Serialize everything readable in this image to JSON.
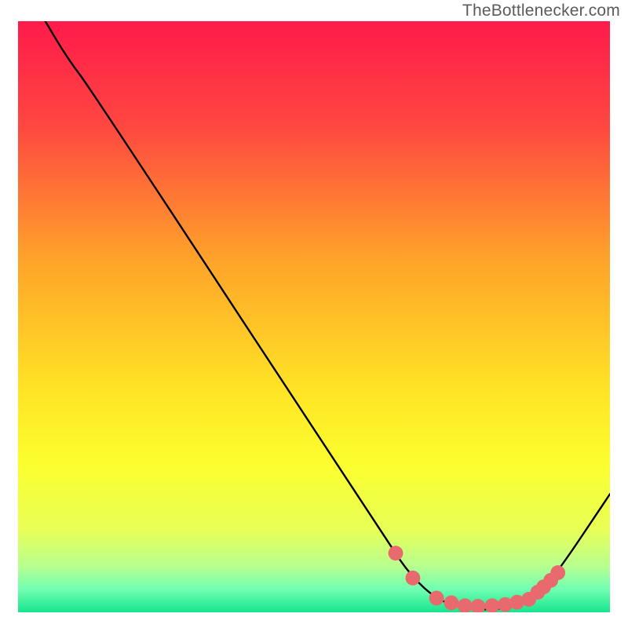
{
  "attribution": "TheBottlenecker.com",
  "chart_data": {
    "type": "line",
    "title": "",
    "xlabel": "",
    "ylabel": "",
    "xlim": [
      0,
      100
    ],
    "ylim": [
      0,
      100
    ],
    "gradient_stops": [
      {
        "offset": 0,
        "color": "#ff1a4b"
      },
      {
        "offset": 18,
        "color": "#ff4840"
      },
      {
        "offset": 40,
        "color": "#ffa22a"
      },
      {
        "offset": 62,
        "color": "#ffe325"
      },
      {
        "offset": 75,
        "color": "#fbff2e"
      },
      {
        "offset": 86,
        "color": "#e8ff56"
      },
      {
        "offset": 92,
        "color": "#baff8e"
      },
      {
        "offset": 96,
        "color": "#73ffb2"
      },
      {
        "offset": 100,
        "color": "#17e58e"
      }
    ],
    "series": [
      {
        "name": "curve",
        "points": [
          {
            "x": 4.6,
            "y": 100.0
          },
          {
            "x": 8.3,
            "y": 93.8
          },
          {
            "x": 12.5,
            "y": 88.2
          },
          {
            "x": 62.5,
            "y": 11.8
          },
          {
            "x": 66.5,
            "y": 6.0
          },
          {
            "x": 71.0,
            "y": 2.0
          },
          {
            "x": 76.0,
            "y": 0.5
          },
          {
            "x": 82.0,
            "y": 0.5
          },
          {
            "x": 86.5,
            "y": 1.8
          },
          {
            "x": 90.5,
            "y": 5.8
          },
          {
            "x": 100.0,
            "y": 20.0
          }
        ]
      }
    ],
    "markers": {
      "color": "#e86a6f",
      "radius_pct": 1.25,
      "points": [
        {
          "x": 63.8,
          "y": 10.0
        },
        {
          "x": 66.7,
          "y": 5.8
        },
        {
          "x": 70.7,
          "y": 2.4
        },
        {
          "x": 73.2,
          "y": 1.6
        },
        {
          "x": 75.5,
          "y": 1.1
        },
        {
          "x": 77.7,
          "y": 1.0
        },
        {
          "x": 80.1,
          "y": 1.1
        },
        {
          "x": 82.3,
          "y": 1.3
        },
        {
          "x": 84.3,
          "y": 1.7
        },
        {
          "x": 86.3,
          "y": 2.2
        },
        {
          "x": 87.8,
          "y": 3.4
        },
        {
          "x": 88.8,
          "y": 4.3
        },
        {
          "x": 90.0,
          "y": 5.4
        },
        {
          "x": 91.2,
          "y": 6.7
        }
      ]
    }
  }
}
